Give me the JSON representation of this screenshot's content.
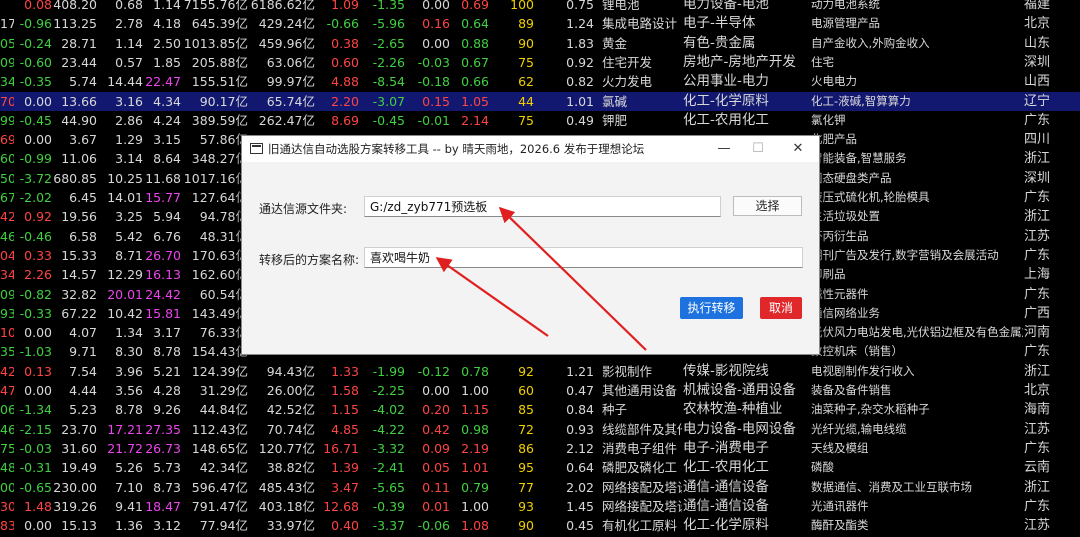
{
  "grid": {
    "rows": [
      {
        "cells": [
          "",
          "0.08",
          "408.20",
          "0.68",
          "1.14",
          "7155.76亿",
          "6186.62亿",
          "1.09",
          "-1.35",
          "0.00",
          "0.69",
          "100",
          "0.75",
          "锂电池",
          "电力设备-电池",
          "动力电池系统",
          "福建"
        ],
        "colors": [
          "w",
          "r",
          "w",
          "w",
          "w",
          "w",
          "w",
          "r",
          "g",
          "w",
          "r",
          "y",
          "w",
          "w",
          "w",
          "w",
          "w"
        ]
      },
      {
        "cells": [
          "17",
          "-0.96",
          "113.25",
          "2.78",
          "4.18",
          "645.39亿",
          "429.24亿",
          "-0.66",
          "-5.96",
          "0.16",
          "0.64",
          "89",
          "1.24",
          "集成电路设计",
          "电子-半导体",
          "电源管理产品",
          "北京"
        ],
        "colors": [
          "w",
          "g",
          "w",
          "w",
          "w",
          "w",
          "w",
          "g",
          "g",
          "r",
          "g",
          "y",
          "w",
          "w",
          "w",
          "w",
          "w"
        ]
      },
      {
        "cells": [
          "05",
          "-0.24",
          "28.71",
          "1.14",
          "2.50",
          "1013.85亿",
          "459.96亿",
          "0.38",
          "-2.65",
          "0.00",
          "0.88",
          "90",
          "1.83",
          "黄金",
          "有色-贵金属",
          "自产金收入,外购金收入",
          "山东"
        ],
        "colors": [
          "g",
          "g",
          "w",
          "w",
          "w",
          "w",
          "w",
          "r",
          "g",
          "w",
          "g",
          "y",
          "w",
          "w",
          "w",
          "w",
          "w"
        ]
      },
      {
        "cells": [
          "09",
          "-0.60",
          "23.44",
          "0.57",
          "1.85",
          "205.88亿",
          "63.06亿",
          "0.60",
          "-2.26",
          "-0.03",
          "0.67",
          "75",
          "0.92",
          "住宅开发",
          "房地产-房地产开发",
          "住宅",
          "深圳"
        ],
        "colors": [
          "g",
          "g",
          "w",
          "w",
          "w",
          "w",
          "w",
          "r",
          "g",
          "g",
          "g",
          "y",
          "w",
          "w",
          "w",
          "w",
          "w"
        ]
      },
      {
        "cells": [
          "34",
          "-0.35",
          "5.74",
          "14.44",
          "22.47",
          "155.51亿",
          "99.97亿",
          "4.88",
          "-8.54",
          "-0.18",
          "0.66",
          "62",
          "0.82",
          "火力发电",
          "公用事业-电力",
          "火电电力",
          "山西"
        ],
        "colors": [
          "g",
          "g",
          "w",
          "w",
          "m",
          "w",
          "w",
          "r",
          "g",
          "g",
          "g",
          "y",
          "w",
          "w",
          "w",
          "w",
          "w"
        ]
      },
      {
        "cells": [
          "70",
          "0.00",
          "13.66",
          "3.16",
          "4.34",
          "90.17亿",
          "65.74亿",
          "2.20",
          "-3.07",
          "0.15",
          "1.05",
          "44",
          "1.01",
          "氯碱",
          "化工-化学原料",
          "化工-液碱,智算算力",
          "辽宁"
        ],
        "colors": [
          "r",
          "w",
          "w",
          "w",
          "w",
          "w",
          "w",
          "r",
          "g",
          "r",
          "r",
          "y",
          "w",
          "w",
          "w",
          "w",
          "w"
        ]
      },
      {
        "cells": [
          "99",
          "-0.45",
          "44.90",
          "2.86",
          "4.24",
          "389.59亿",
          "262.47亿",
          "8.69",
          "-0.45",
          "-0.01",
          "2.14",
          "75",
          "0.49",
          "钾肥",
          "化工-农用化工",
          "氯化钾",
          "广东"
        ],
        "colors": [
          "g",
          "g",
          "w",
          "w",
          "w",
          "w",
          "w",
          "r",
          "g",
          "g",
          "r",
          "y",
          "w",
          "w",
          "w",
          "w",
          "w"
        ]
      },
      {
        "cells": [
          "69",
          "0.00",
          "3.67",
          "1.29",
          "3.15",
          "57.86亿",
          "",
          "",
          "",
          "",
          "",
          "",
          "",
          "",
          "",
          "化肥产品",
          "四川"
        ],
        "colors": [
          "r",
          "w",
          "w",
          "w",
          "w",
          "w",
          "w",
          "w",
          "w",
          "w",
          "w",
          "w",
          "w",
          "w",
          "w",
          "w",
          "w"
        ]
      },
      {
        "cells": [
          "60",
          "-0.99",
          "11.06",
          "3.14",
          "8.64",
          "348.27亿",
          "",
          "",
          "",
          "",
          "",
          "",
          "",
          "",
          "",
          "智能装备,智慧服务",
          "浙江"
        ],
        "colors": [
          "g",
          "g",
          "w",
          "w",
          "w",
          "w",
          "w",
          "w",
          "w",
          "w",
          "w",
          "w",
          "w",
          "w",
          "w",
          "w",
          "w"
        ]
      },
      {
        "cells": [
          "50",
          "-3.72",
          "680.85",
          "10.25",
          "11.68",
          "1017.16亿",
          "",
          "",
          "",
          "",
          "",
          "",
          "",
          "",
          "",
          "固态硬盘类产品",
          "深圳"
        ],
        "colors": [
          "g",
          "g",
          "w",
          "w",
          "w",
          "w",
          "w",
          "w",
          "w",
          "w",
          "w",
          "w",
          "w",
          "w",
          "w",
          "w",
          "w"
        ]
      },
      {
        "cells": [
          "67",
          "-2.02",
          "6.45",
          "14.01",
          "15.77",
          "127.64亿",
          "",
          "",
          "",
          "",
          "",
          "",
          "",
          "",
          "",
          "液压式硫化机,轮胎模具",
          "广东"
        ],
        "colors": [
          "g",
          "g",
          "w",
          "w",
          "m",
          "w",
          "w",
          "w",
          "w",
          "w",
          "w",
          "w",
          "w",
          "w",
          "w",
          "w",
          "w"
        ]
      },
      {
        "cells": [
          "42",
          "0.92",
          "19.56",
          "3.25",
          "5.94",
          "94.78亿",
          "",
          "",
          "",
          "",
          "",
          "",
          "",
          "",
          "",
          "生活垃圾处置",
          "浙江"
        ],
        "colors": [
          "r",
          "r",
          "w",
          "w",
          "w",
          "w",
          "w",
          "w",
          "w",
          "w",
          "w",
          "w",
          "w",
          "w",
          "w",
          "w",
          "w"
        ]
      },
      {
        "cells": [
          "46",
          "-0.46",
          "6.58",
          "5.42",
          "6.76",
          "48.31亿",
          "",
          "",
          "",
          "",
          "",
          "",
          "",
          "",
          "",
          "坏丙衍生品",
          "江苏"
        ],
        "colors": [
          "g",
          "g",
          "w",
          "w",
          "w",
          "w",
          "w",
          "w",
          "w",
          "w",
          "w",
          "w",
          "w",
          "w",
          "w",
          "w",
          "w"
        ]
      },
      {
        "cells": [
          "04",
          "0.33",
          "15.33",
          "8.71",
          "26.70",
          "170.63亿",
          "",
          "",
          "",
          "",
          "",
          "",
          "",
          "",
          "",
          "期刊广告及发行,数字营销及会展活动",
          "广东"
        ],
        "colors": [
          "r",
          "r",
          "w",
          "w",
          "m",
          "w",
          "w",
          "w",
          "w",
          "w",
          "w",
          "w",
          "w",
          "w",
          "w",
          "w",
          "w"
        ]
      },
      {
        "cells": [
          "34",
          "2.26",
          "14.57",
          "12.29",
          "16.13",
          "162.60亿",
          "",
          "",
          "",
          "",
          "",
          "",
          "",
          "",
          "",
          "印刷品",
          "上海"
        ],
        "colors": [
          "r",
          "r",
          "w",
          "w",
          "m",
          "w",
          "w",
          "w",
          "w",
          "w",
          "w",
          "w",
          "w",
          "w",
          "w",
          "w",
          "w"
        ]
      },
      {
        "cells": [
          "09",
          "-0.82",
          "32.82",
          "20.01",
          "24.42",
          "60.54亿",
          "",
          "",
          "",
          "",
          "",
          "",
          "",
          "",
          "",
          "磁性元器件",
          "广东"
        ],
        "colors": [
          "g",
          "g",
          "w",
          "m",
          "m",
          "w",
          "w",
          "w",
          "w",
          "w",
          "w",
          "w",
          "w",
          "w",
          "w",
          "w",
          "w"
        ]
      },
      {
        "cells": [
          "93",
          "-0.33",
          "67.22",
          "10.42",
          "15.81",
          "143.49亿",
          "",
          "",
          "",
          "",
          "",
          "",
          "",
          "",
          "",
          "通信网络业务",
          "广西"
        ],
        "colors": [
          "g",
          "g",
          "w",
          "w",
          "m",
          "w",
          "w",
          "w",
          "w",
          "w",
          "w",
          "w",
          "w",
          "w",
          "w",
          "w",
          "w"
        ]
      },
      {
        "cells": [
          "10",
          "0.00",
          "4.07",
          "1.34",
          "3.17",
          "76.33亿",
          "",
          "",
          "",
          "",
          "",
          "",
          "",
          "",
          "",
          "光伏风力电站发电,光伏铝边框及有色金属加工",
          "河南"
        ],
        "colors": [
          "r",
          "w",
          "w",
          "w",
          "w",
          "w",
          "w",
          "w",
          "w",
          "w",
          "w",
          "w",
          "w",
          "w",
          "w",
          "w",
          "w"
        ]
      },
      {
        "cells": [
          "35",
          "-1.03",
          "9.71",
          "8.30",
          "8.78",
          "154.43亿",
          "",
          "",
          "",
          "",
          "",
          "",
          "",
          "",
          "",
          "数控机床（销售）",
          "广东"
        ],
        "colors": [
          "g",
          "g",
          "w",
          "w",
          "w",
          "w",
          "w",
          "w",
          "w",
          "w",
          "w",
          "w",
          "w",
          "w",
          "w",
          "w",
          "w"
        ]
      },
      {
        "cells": [
          "42",
          "0.13",
          "7.54",
          "3.96",
          "5.21",
          "124.39亿",
          "94.43亿",
          "1.33",
          "-1.99",
          "-0.12",
          "0.78",
          "92",
          "1.21",
          "影视制作",
          "传媒-影视院线",
          "电视剧制作发行收入",
          "浙江"
        ],
        "colors": [
          "r",
          "r",
          "w",
          "w",
          "w",
          "w",
          "w",
          "r",
          "g",
          "g",
          "g",
          "y",
          "w",
          "w",
          "w",
          "w",
          "w"
        ]
      },
      {
        "cells": [
          "47",
          "0.00",
          "4.44",
          "3.56",
          "4.28",
          "31.29亿",
          "26.00亿",
          "1.58",
          "-2.25",
          "0.00",
          "1.00",
          "60",
          "0.47",
          "其他通用设备",
          "机械设备-通用设备",
          "装备及备件销售",
          "北京"
        ],
        "colors": [
          "r",
          "w",
          "w",
          "w",
          "w",
          "w",
          "w",
          "r",
          "g",
          "w",
          "w",
          "y",
          "w",
          "w",
          "w",
          "w",
          "w"
        ]
      },
      {
        "cells": [
          "06",
          "-1.34",
          "5.23",
          "8.78",
          "9.26",
          "44.84亿",
          "42.52亿",
          "1.15",
          "-4.02",
          "0.20",
          "1.15",
          "85",
          "0.84",
          "种子",
          "农林牧渔-种植业",
          "油菜种子,杂交水稻种子",
          "海南"
        ],
        "colors": [
          "g",
          "g",
          "w",
          "w",
          "w",
          "w",
          "w",
          "r",
          "g",
          "r",
          "r",
          "y",
          "w",
          "w",
          "w",
          "w",
          "w"
        ]
      },
      {
        "cells": [
          "46",
          "-2.15",
          "23.70",
          "17.21",
          "27.35",
          "112.43亿",
          "70.74亿",
          "4.85",
          "-4.22",
          "0.42",
          "0.98",
          "72",
          "0.93",
          "线缆部件及其他",
          "电力设备-电网设备",
          "光纤光缆,输电线缆",
          "江苏"
        ],
        "colors": [
          "g",
          "g",
          "w",
          "m",
          "m",
          "w",
          "w",
          "r",
          "g",
          "r",
          "g",
          "y",
          "w",
          "w",
          "w",
          "w",
          "w"
        ]
      },
      {
        "cells": [
          "75",
          "-0.03",
          "31.60",
          "21.72",
          "26.73",
          "148.65亿",
          "120.77亿",
          "16.71",
          "-3.32",
          "0.09",
          "2.19",
          "86",
          "2.12",
          "消费电子组件",
          "电子-消费电子",
          "天线及模组",
          "广东"
        ],
        "colors": [
          "g",
          "g",
          "w",
          "m",
          "m",
          "w",
          "w",
          "r",
          "g",
          "r",
          "r",
          "y",
          "w",
          "w",
          "w",
          "w",
          "w"
        ]
      },
      {
        "cells": [
          "48",
          "-0.31",
          "19.49",
          "5.26",
          "5.73",
          "42.34亿",
          "38.82亿",
          "1.39",
          "-2.41",
          "0.05",
          "1.01",
          "95",
          "0.64",
          "磷肥及磷化工",
          "化工-农用化工",
          "磷酸",
          "云南"
        ],
        "colors": [
          "g",
          "g",
          "w",
          "w",
          "w",
          "w",
          "w",
          "r",
          "g",
          "r",
          "r",
          "y",
          "w",
          "w",
          "w",
          "w",
          "w"
        ]
      },
      {
        "cells": [
          "00",
          "-0.65",
          "230.00",
          "7.10",
          "8.73",
          "596.47亿",
          "485.43亿",
          "3.47",
          "-5.65",
          "0.11",
          "0.79",
          "77",
          "2.02",
          "网络接配及塔设",
          "通信-通信设备",
          "数据通信、消费及工业互联市场",
          "浙江"
        ],
        "colors": [
          "g",
          "g",
          "w",
          "w",
          "w",
          "w",
          "w",
          "r",
          "g",
          "r",
          "g",
          "y",
          "w",
          "w",
          "w",
          "w",
          "w"
        ]
      },
      {
        "cells": [
          "30",
          "1.48",
          "319.26",
          "9.41",
          "18.47",
          "791.47亿",
          "403.18亿",
          "12.68",
          "-0.39",
          "0.01",
          "1.00",
          "93",
          "1.45",
          "网络接配及塔设",
          "通信-通信设备",
          "光通讯器件",
          "广东"
        ],
        "colors": [
          "r",
          "r",
          "w",
          "w",
          "m",
          "w",
          "w",
          "r",
          "g",
          "r",
          "w",
          "y",
          "w",
          "w",
          "w",
          "w",
          "w"
        ]
      },
      {
        "cells": [
          "83",
          "0.00",
          "15.13",
          "1.36",
          "3.12",
          "77.94亿",
          "33.97亿",
          "0.40",
          "-3.37",
          "-0.06",
          "1.08",
          "90",
          "0.45",
          "有机化工原料",
          "化工-化学原料",
          "酶酐及酯类",
          "江苏"
        ],
        "colors": [
          "r",
          "w",
          "w",
          "w",
          "w",
          "w",
          "w",
          "r",
          "g",
          "g",
          "r",
          "y",
          "w",
          "w",
          "w",
          "w",
          "w"
        ]
      }
    ]
  },
  "dialog": {
    "title": "旧通达信自动选股方案转移工具 -- by 晴天雨地，2026.6 发布于理想论坛",
    "min_glyph": "—",
    "max_glyph": "☐",
    "close_glyph": "✕",
    "source_label": "通达信源文件夹:",
    "source_value": "G:/zd_zyb771预选板",
    "browse_label": "选择",
    "name_label": "转移后的方案名称:",
    "name_value": "喜欢喝牛奶",
    "execute_label": "执行转移",
    "cancel_label": "取消"
  },
  "colors": {
    "exec_button": "#1e72e0",
    "cancel_button": "#e0282a",
    "arrow": "#e02020",
    "selected_row": "#121870"
  }
}
